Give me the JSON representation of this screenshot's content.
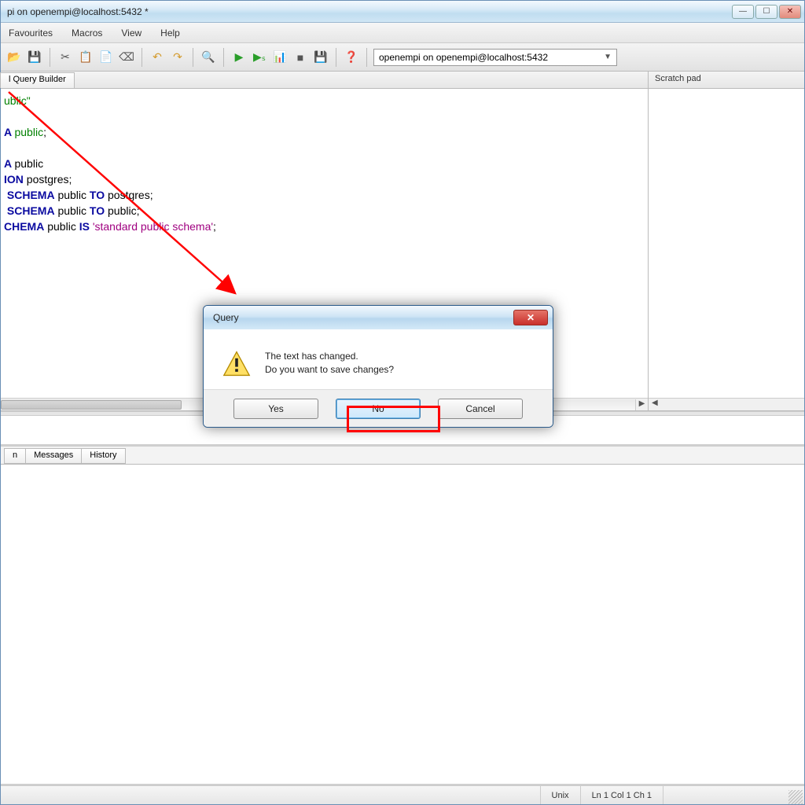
{
  "title": "pi on openempi@localhost:5432 *",
  "menu": {
    "fav": "Favourites",
    "macros": "Macros",
    "view": "View",
    "help": "Help"
  },
  "db_selector": "openempi on openempi@localhost:5432",
  "editor_tab": "l Query Builder",
  "scratch_title": "Scratch pad",
  "code": {
    "l1": "ublic\"",
    "l2": "",
    "l3_a": "A ",
    "l3_b": "public",
    "l3_c": ";",
    "l4": "",
    "l5_a": "A ",
    "l5_b": "public",
    "l6_a": "ION ",
    "l6_b": "postgres;",
    "l7_a": " SCHEMA",
    "l7_b": " public ",
    "l7_c": "TO",
    "l7_d": " postgres;",
    "l8_a": " SCHEMA",
    "l8_b": " public ",
    "l8_c": "TO",
    "l8_d": " public;",
    "l9_a": "CHEMA",
    "l9_b": " public ",
    "l9_c": "IS",
    "l9_d": " 'standard public schema'",
    "l9_e": ";"
  },
  "bottom_tabs": {
    "t1": "n",
    "t2": "Messages",
    "t3": "History"
  },
  "status": {
    "mode": "Unix",
    "pos": "Ln 1 Col 1 Ch 1"
  },
  "dialog": {
    "title": "Query",
    "line1": "The text has changed.",
    "line2": "Do you want to save changes?",
    "yes": "Yes",
    "no": "No",
    "cancel": "Cancel"
  }
}
